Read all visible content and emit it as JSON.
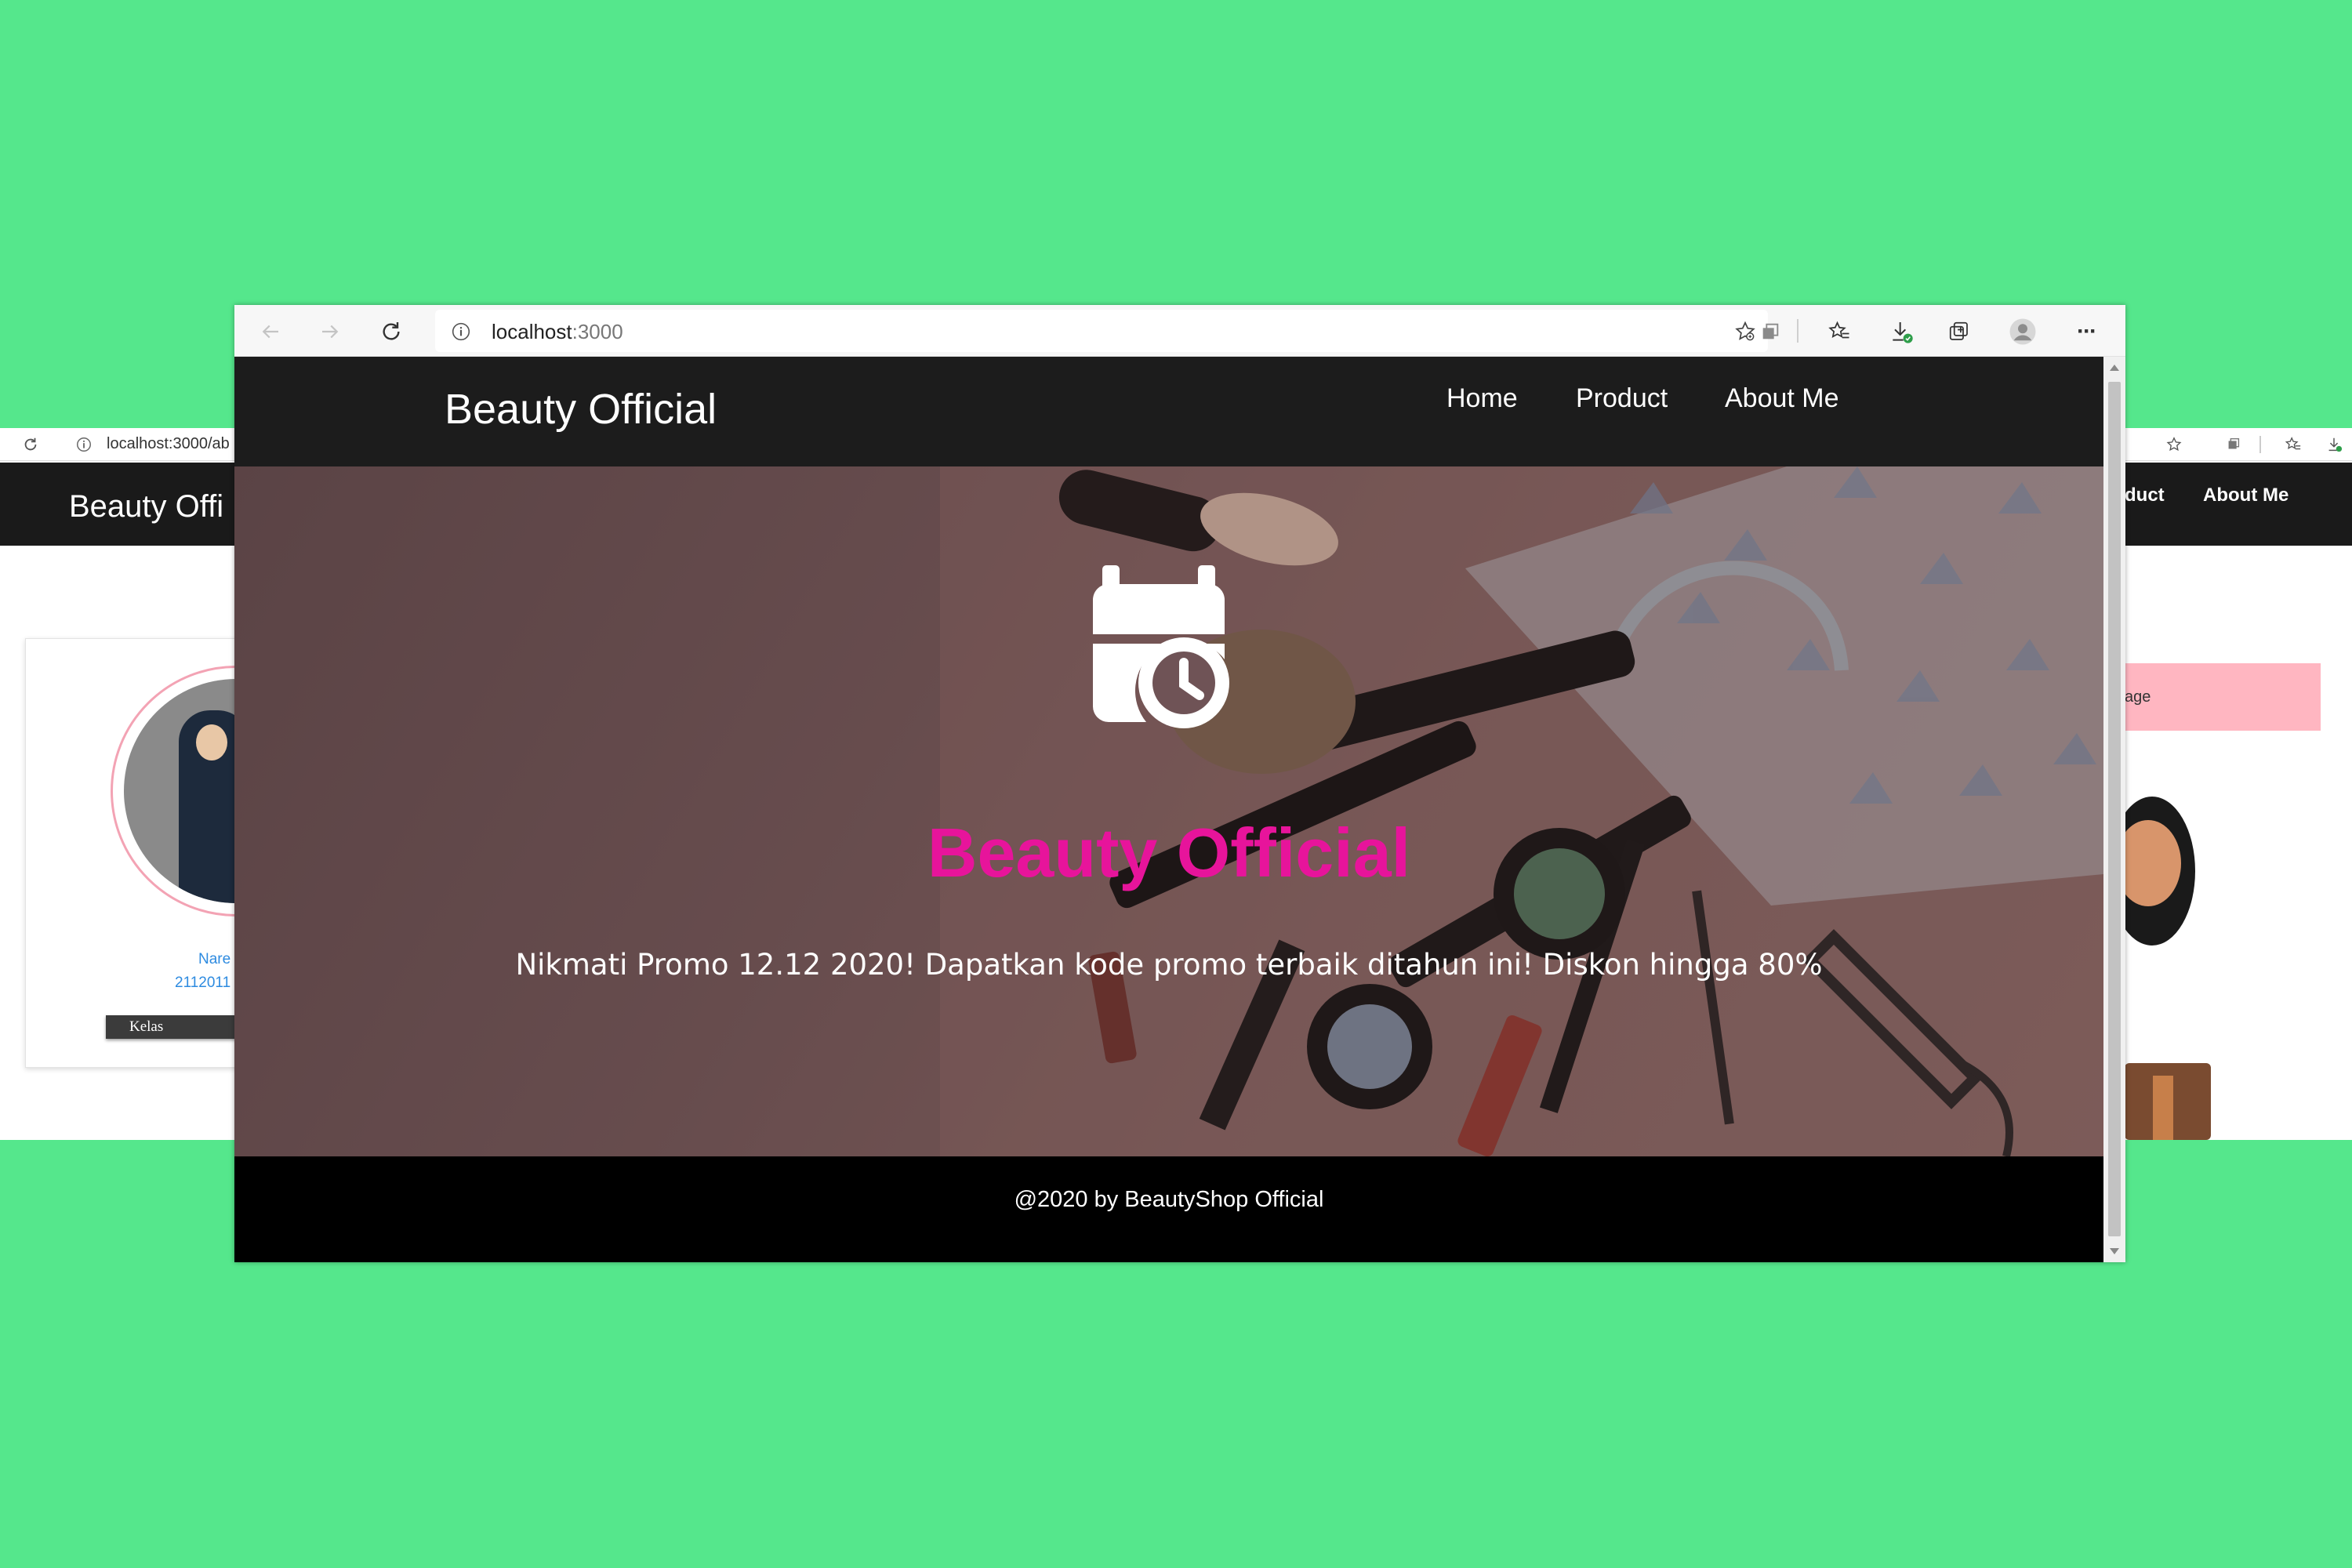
{
  "background_left_window": {
    "url": "localhost:3000/ab",
    "brand": "Beauty Offi",
    "profile": {
      "name": "Nare",
      "nim": "2112011",
      "kelas_label": "Kelas"
    }
  },
  "background_right_window": {
    "nav_product": "duct",
    "nav_about": "About Me",
    "pink_box_text": "age"
  },
  "browser": {
    "url_host": "localhost",
    "url_port": ":3000",
    "more_label": "···"
  },
  "navbar": {
    "brand": "Beauty Official",
    "links": [
      {
        "label": "Home"
      },
      {
        "label": "Product"
      },
      {
        "label": "About Me"
      }
    ]
  },
  "hero": {
    "icon": "calendar-clock-icon",
    "title": "Beauty Official",
    "text": "Nikmati Promo 12.12 2020! Dapatkan kode promo terbaik ditahun ini! Diskon hingga 80%",
    "title_color": "#e7149b"
  },
  "footer": {
    "text": "@2020 by BeautyShop Official"
  },
  "colors": {
    "page_background": "#55e78c",
    "navbar": "#1c1c1c",
    "footer": "#000000"
  }
}
